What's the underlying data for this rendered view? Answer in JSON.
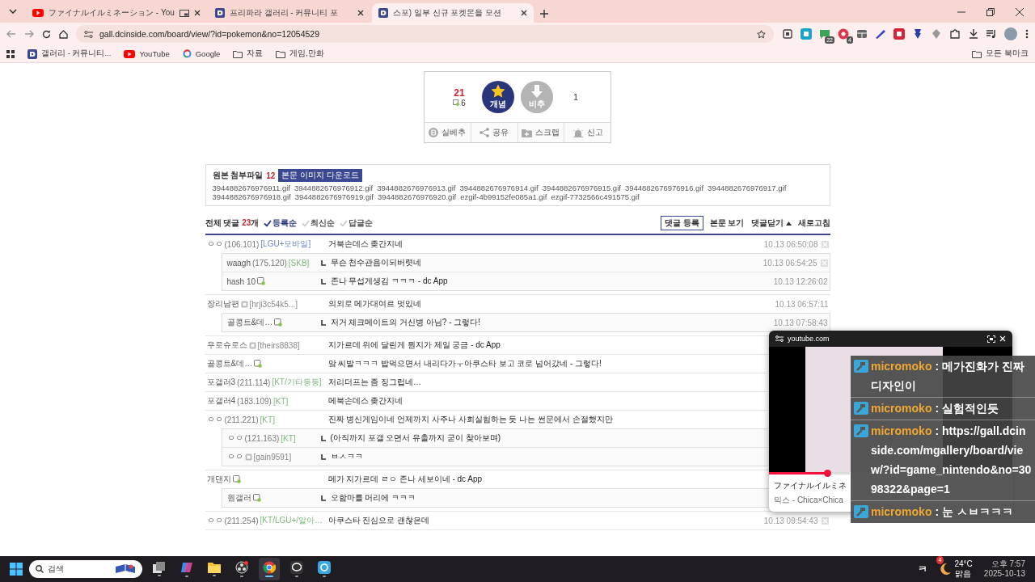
{
  "browser": {
    "tabs": [
      {
        "title": "ファイナルイルミネーション - You",
        "kind": "youtube",
        "media": true,
        "selected": false
      },
      {
        "title": "프리파라 갤러리 - 커뮤니티 포",
        "kind": "dc",
        "media": false,
        "selected": false
      },
      {
        "title": "스포) 일부 신규 포켓몬을 모션",
        "kind": "dc",
        "media": false,
        "selected": true
      }
    ],
    "url": "gall.dcinside.com/board/view/?id=pokemon&no=12054529",
    "extensions": [
      {
        "kind": "scan"
      },
      {
        "kind": "square",
        "color": "#1aa3c9"
      },
      {
        "kind": "chat",
        "badge": "22"
      },
      {
        "kind": "record",
        "badge": "4"
      },
      {
        "kind": "grid"
      },
      {
        "kind": "pen"
      },
      {
        "kind": "square",
        "color": "#d6233c"
      },
      {
        "kind": "pin"
      },
      {
        "kind": "gem"
      },
      {
        "kind": "puzzle"
      }
    ],
    "bookmarks": [
      {
        "label": "갤러리 - 커뮤니티...",
        "kind": "dc"
      },
      {
        "label": "YouTube",
        "kind": "youtube"
      },
      {
        "label": "Google",
        "kind": "google"
      },
      {
        "label": "자료",
        "kind": "folder"
      },
      {
        "label": "게임,만화",
        "kind": "folder"
      }
    ],
    "all_bookmarks": "모든 북마크"
  },
  "vote": {
    "score": "21",
    "fixed_count": "6",
    "up_label": "개념",
    "down_label": "비추",
    "down_count": "1",
    "actions": [
      {
        "label": "실베추",
        "kind": "b"
      },
      {
        "label": "공유",
        "kind": "share"
      },
      {
        "label": "스크랩",
        "kind": "scrap"
      },
      {
        "label": "신고",
        "kind": "siren"
      }
    ]
  },
  "attachments": {
    "label": "원본 첨부파일",
    "count": "12",
    "download": "본문 이미지 다운로드",
    "files": [
      "3944882676976911.gif",
      "3944882676976912.gif",
      "3944882676976913.gif",
      "3944882676976914.gif",
      "3944882676976915.gif",
      "3944882676976916.gif",
      "3944882676976917.gif",
      "3944882676976918.gif",
      "3944882676976919.gif",
      "3944882676976920.gif",
      "ezgif-4b99152fe085a1.gif",
      "ezgif-7732566c491575.gif"
    ]
  },
  "comments_header": {
    "label": "전체 댓글",
    "count": "23",
    "unit": "개",
    "sorts": [
      {
        "label": "등록순",
        "selected": true
      },
      {
        "label": "최신순",
        "selected": false
      },
      {
        "label": "답글순",
        "selected": false
      }
    ],
    "actions": [
      {
        "label": "댓글 등록",
        "kind": "boxed"
      },
      {
        "label": "본문 보기",
        "kind": "plain"
      },
      {
        "label": "댓글닫기",
        "kind": "toggle"
      },
      {
        "label": "새로고침",
        "kind": "plain"
      }
    ]
  },
  "comments": [
    {
      "name": "ㅇㅇ",
      "ip": "(106.101)",
      "tag": {
        "text": "[LGU+모바일]",
        "color": "#6a86c8"
      },
      "text": "거북손데스 좆간지네",
      "time": "10.13 06:50:08",
      "deletable": true,
      "children": [
        {
          "name": "waagh",
          "ip": "(175.120)",
          "tag": {
            "text": "[SKB]",
            "color": "#7cb87c"
          },
          "text": "무슨 천수관음이되버렷네",
          "time": "10.13 06:54:25",
          "deletable": true
        },
        {
          "name": "hash  10",
          "kind": "fixed",
          "text": "존나 무섭게생김 ㅋㅋㅋ - dc App",
          "time": "10.13 12:26:02",
          "deletable": false
        }
      ]
    },
    {
      "name": "장리남편",
      "kind": "semi",
      "user_id": "[hrji3c54k5...]",
      "text": "의외로 메가대여르 멋있네",
      "time": "10.13 06:57:11",
      "deletable": false,
      "children": [
        {
          "name": "골콩트&데…",
          "kind": "fixed",
          "text": "저거 체크메이트의 거신병 아님? - 그렇다!",
          "time": "10.13 07:58:43",
          "deletable": false
        }
      ]
    },
    {
      "name": "우로슈로스",
      "kind": "semi",
      "user_id": "[theirs8838]",
      "text": "지가르데 위에 달린게 뭔지가 제일 궁금 - dc App",
      "deletable": false
    },
    {
      "name": "골콩트&데…",
      "kind": "fixed",
      "text": "앜 씨발ㅋㅋㅋ 밥먹으면서 내리다가ㅜ아쿠스타 보고 코로 넘어갔네 - 그렇다!",
      "deletable": false
    },
    {
      "name": "포갤러3",
      "ip": "(211.114)",
      "tag": {
        "text": "[KT/기타등등]",
        "color": "#7cb87c"
      },
      "text": "저리더프는 좀 징그럽네…",
      "deletable": false
    },
    {
      "name": "포갤러4",
      "ip": "(183.109)",
      "tag": {
        "text": "[KT]",
        "color": "#7cb87c"
      },
      "text": "메북손데스 좆간지네",
      "deletable": false
    },
    {
      "name": "ㅇㅇ",
      "ip": "(211.221)",
      "tag": {
        "text": "[KT]",
        "color": "#7cb87c"
      },
      "text": "진짜 병신게임이네 언제까지 사주나 사회실험하는 듯 나는 썬문에서 손절했지만",
      "deletable": false,
      "children": [
        {
          "name": "ㅇㅇ",
          "ip": "(121.163)",
          "tag": {
            "text": "[KT]",
            "color": "#7cb87c"
          },
          "text": "(아직까지 포갤 오면서 유출까지 굳이 찾아보며)",
          "deletable": false
        },
        {
          "name": "ㅇㅇ",
          "kind": "semi",
          "user_id": "[gain9591]",
          "text": "ㅂㅅㅋㅋ",
          "deletable": false
        }
      ]
    },
    {
      "name": "개댄지",
      "kind": "fixed",
      "text": "메가 지가르데 ㄹㅇ 존나 세보이네 - dc App",
      "deletable": false,
      "children": [
        {
          "name": "원갤러",
          "kind": "fixed",
          "text": "오함마를 머리에 ㅋㅋㅋ",
          "deletable": false
        }
      ]
    },
    {
      "name": "ㅇㅇ",
      "ip": "(211.254)",
      "tag": {
        "text": "[KT/LGU+/알아…",
        "color": "#7cb87c"
      },
      "text": "아쿠스타 진심으로 괜찮은데",
      "time": "10.13 09:54:43",
      "deletable": true
    }
  ],
  "mini_player": {
    "site": "youtube.com",
    "title": "ファイナルイルミネ",
    "subtitle": "믹스 - Chica×Chica",
    "level": 0.72
  },
  "chat": [
    {
      "user": "micromoko",
      "text": ": 메가진화가 진짜 디자인이"
    },
    {
      "user": "micromoko",
      "text": ": 실험적인듯"
    },
    {
      "user": "micromoko",
      "text": ": https://gall.dcinside.com/mgallery/board/view/?id=game_nintendo&no=3098322&page=1"
    },
    {
      "user": "micromoko",
      "text": ": 눈 ㅅㅂㅋㅋㅋ"
    }
  ],
  "taskbar": {
    "search_placeholder": "검색",
    "apps": [
      {
        "kind": "taskview",
        "active": false
      },
      {
        "kind": "copilot",
        "active": false
      },
      {
        "kind": "explorer",
        "active": false
      },
      {
        "kind": "obs",
        "active": false
      },
      {
        "kind": "chrome",
        "active": true
      },
      {
        "kind": "line",
        "active": false
      },
      {
        "kind": "app",
        "active": false
      }
    ],
    "ime": "ㅋ",
    "weather": {
      "badge": "4",
      "temp": "24°C",
      "condition": "맑음"
    },
    "clock": {
      "time": "오후 7:57",
      "date": "2025-10-13"
    }
  }
}
